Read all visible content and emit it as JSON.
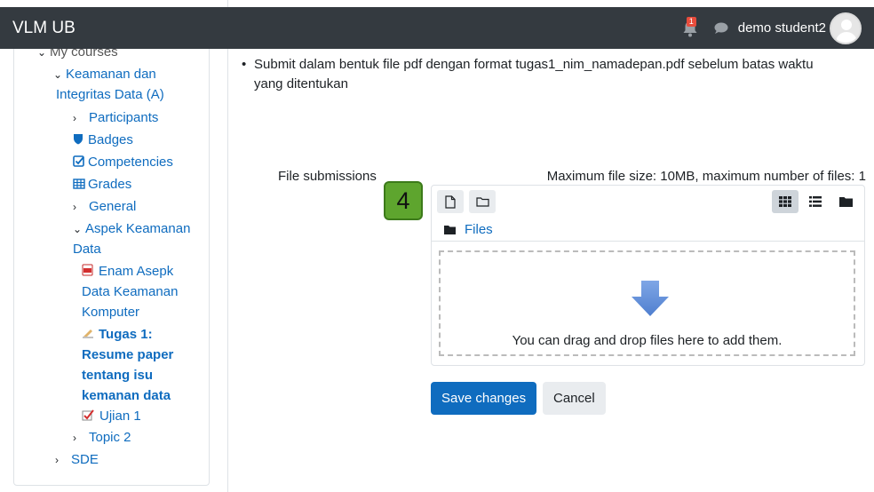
{
  "navbar": {
    "brand": "VLM UB",
    "notification_count": "1",
    "username": "demo student2"
  },
  "sidebar": {
    "items": [
      {
        "label": "My courses"
      },
      {
        "label": "Keamanan dan"
      },
      {
        "label": "Integritas Data (A)"
      },
      {
        "label": "Participants"
      },
      {
        "label": "Badges"
      },
      {
        "label": "Competencies"
      },
      {
        "label": "Grades"
      },
      {
        "label": "General"
      },
      {
        "label": "Aspek Keamanan"
      },
      {
        "label": "Data"
      },
      {
        "label": "Enam Asepk"
      },
      {
        "label": "Data Keamanan"
      },
      {
        "label": "Komputer"
      },
      {
        "label": "Tugas 1:"
      },
      {
        "label": "Resume paper"
      },
      {
        "label": "tentang isu"
      },
      {
        "label": "kemanan data"
      },
      {
        "label": "Ujian 1"
      },
      {
        "label": "Topic 2"
      },
      {
        "label": "SDE"
      }
    ]
  },
  "main": {
    "instruction_line1": "Submit dalam bentuk file pdf dengan format tugas1_nim_namadepan.pdf sebelum batas waktu",
    "instruction_line2": "yang ditentukan",
    "file_submissions_label": "File submissions",
    "file_limits": "Maximum file size: 10MB, maximum number of files: 1",
    "step_number": "4",
    "path_label": "Files",
    "drop_text": "You can drag and drop files here to add them.",
    "save_label": "Save changes",
    "cancel_label": "Cancel"
  },
  "colors": {
    "navbar": "#343a40",
    "link": "#0f6cbf",
    "primary_button": "#0f6cbf",
    "step_badge": "#5ea52e",
    "drop_arrow": "#5a86d4"
  },
  "icons": {
    "notification": "bell-icon",
    "messages": "chat-bubble-icon",
    "add_file": "file-icon",
    "create_folder": "folder-icon",
    "view_icons": "grid-icon",
    "view_list": "list-icon",
    "view_tree": "folder-solid-icon",
    "drop": "arrow-down-icon"
  }
}
